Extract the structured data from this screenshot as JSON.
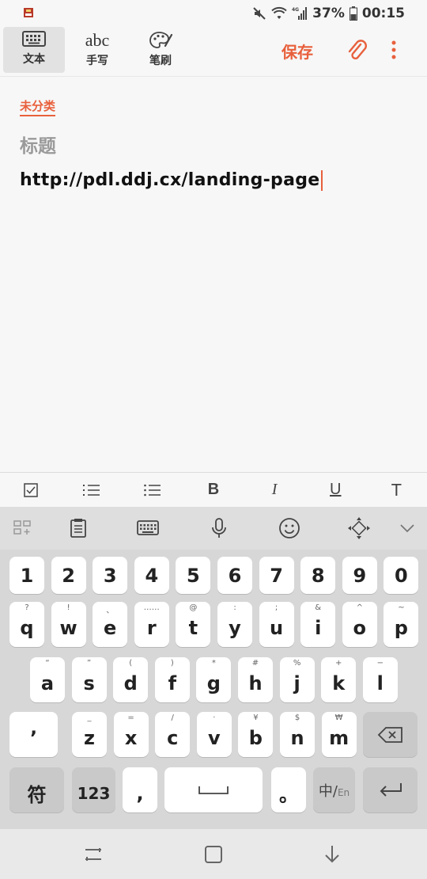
{
  "status": {
    "battery": "37%",
    "time": "00:15",
    "network": "4G"
  },
  "toolbar": {
    "modes": [
      {
        "label": "文本",
        "icon": "keyboard-icon"
      },
      {
        "label": "手写",
        "glyph": "abc",
        "icon": "handwriting-icon"
      },
      {
        "label": "笔刷",
        "icon": "palette-icon"
      }
    ],
    "save_label": "保存"
  },
  "editor": {
    "category": "未分类",
    "title_placeholder": "标题",
    "body_text": "http://pdl.ddj.cx/landing-page"
  },
  "format_bar": {
    "bold": "B",
    "italic": "I",
    "underline": "U",
    "text_color": "T"
  },
  "keyboard": {
    "number_row": [
      "1",
      "2",
      "3",
      "4",
      "5",
      "6",
      "7",
      "8",
      "9",
      "0"
    ],
    "row1": [
      {
        "k": "q",
        "h": "?"
      },
      {
        "k": "w",
        "h": "!"
      },
      {
        "k": "e",
        "h": "、"
      },
      {
        "k": "r",
        "h": "……"
      },
      {
        "k": "t",
        "h": "@"
      },
      {
        "k": "y",
        "h": ":"
      },
      {
        "k": "u",
        "h": ";"
      },
      {
        "k": "i",
        "h": "&"
      },
      {
        "k": "o",
        "h": "^"
      },
      {
        "k": "p",
        "h": "~"
      }
    ],
    "row2": [
      {
        "k": "a",
        "h": "“"
      },
      {
        "k": "s",
        "h": "”"
      },
      {
        "k": "d",
        "h": "("
      },
      {
        "k": "f",
        "h": ")"
      },
      {
        "k": "g",
        "h": "*"
      },
      {
        "k": "h",
        "h": "#"
      },
      {
        "k": "j",
        "h": "%"
      },
      {
        "k": "k",
        "h": "+"
      },
      {
        "k": "l",
        "h": "−"
      }
    ],
    "row3": [
      {
        "k": "z",
        "h": "_"
      },
      {
        "k": "x",
        "h": "="
      },
      {
        "k": "c",
        "h": "/"
      },
      {
        "k": "v",
        "h": "·"
      },
      {
        "k": "b",
        "h": "¥"
      },
      {
        "k": "n",
        "h": "$"
      },
      {
        "k": "m",
        "h": "₩"
      }
    ],
    "apostrophe": "’",
    "symbols_key": "符",
    "numbers_key": "123",
    "comma_key": ",",
    "period_key": "。",
    "lang_key_main": "中/",
    "lang_key_sub": "En"
  },
  "colors": {
    "accent": "#e8603c",
    "keyboard_bg": "#d7d7d7",
    "key_bg": "#ffffff"
  }
}
